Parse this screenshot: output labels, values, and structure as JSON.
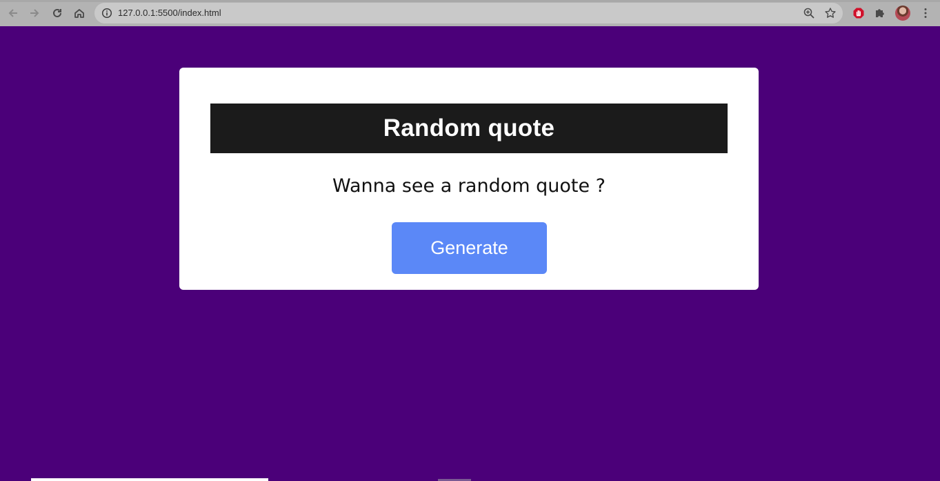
{
  "browser": {
    "url": "127.0.0.1:5500/index.html",
    "icons": {
      "back": "arrow-left-icon",
      "forward": "arrow-right-icon",
      "reload": "reload-icon",
      "home": "home-icon",
      "info": "info-icon",
      "zoom": "zoom-icon",
      "bookmark": "star-icon",
      "extension_block": "stop-hand-icon",
      "extensions": "puzzle-icon",
      "menu": "kebab-menu-icon"
    }
  },
  "page": {
    "background_color": "#4b0079",
    "card": {
      "title": "Random quote",
      "prompt": "Wanna see a random quote ?",
      "button_label": "Generate",
      "button_color": "#5b88f7",
      "header_color": "#1b1b1b"
    }
  }
}
